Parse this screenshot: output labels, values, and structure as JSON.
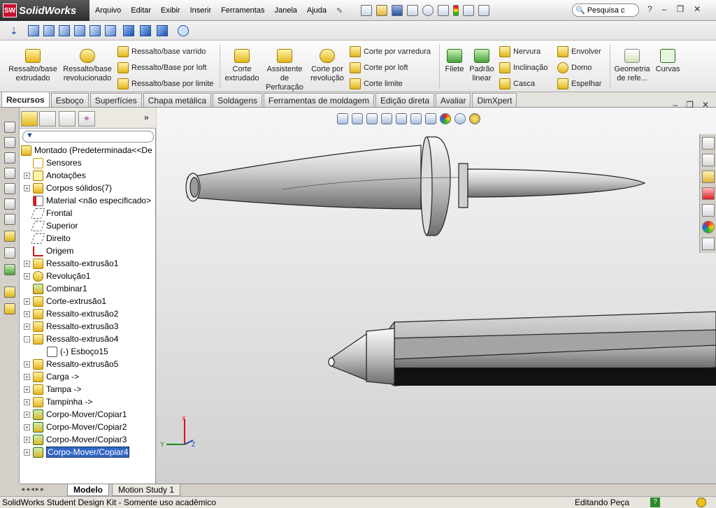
{
  "app": {
    "name": "SolidWorks",
    "logo_letters": "SW"
  },
  "menu": [
    "Arquivo",
    "Editar",
    "Exibir",
    "Inserir",
    "Ferramentas",
    "Janela",
    "Ajuda"
  ],
  "search": {
    "placeholder": "Pesquisa c"
  },
  "command_manager": {
    "big": [
      {
        "label": "Ressalto/base extrudado"
      },
      {
        "label": "Ressalto/base revolucionado"
      },
      {
        "label": "Corte extrudado"
      },
      {
        "label": "Assistente de Perfuração"
      },
      {
        "label": "Corte por revolução"
      },
      {
        "label": "Filete"
      },
      {
        "label": "Padrão linear"
      },
      {
        "label": "Geometria de refe..."
      },
      {
        "label": "Curvas"
      }
    ],
    "small": [
      {
        "label": "Ressalto/base varrido"
      },
      {
        "label": "Ressalto/Base por loft"
      },
      {
        "label": "Ressalto/base por limite"
      },
      {
        "label": "Corte por varredura"
      },
      {
        "label": "Corte por loft"
      },
      {
        "label": "Corte limite"
      },
      {
        "label": "Nervura"
      },
      {
        "label": "Inclinação"
      },
      {
        "label": "Casca"
      },
      {
        "label": "Envolver"
      },
      {
        "label": "Domo"
      },
      {
        "label": "Espelhar"
      }
    ]
  },
  "tabs": [
    "Recursos",
    "Esboço",
    "Superfícies",
    "Chapa metálica",
    "Soldagens",
    "Ferramentas de moldagem",
    "Edição direta",
    "Avaliar",
    "DimXpert"
  ],
  "tree": [
    {
      "label": "Montado  (Predeterminada<<De",
      "expand": "",
      "icon": "part",
      "indent": 0
    },
    {
      "label": "Sensores",
      "expand": "",
      "icon": "sensor",
      "indent": 1
    },
    {
      "label": "Anotações",
      "expand": "+",
      "icon": "annot",
      "indent": 1
    },
    {
      "label": "Corpos sólidos(7)",
      "expand": "+",
      "icon": "folder",
      "indent": 1
    },
    {
      "label": "Material <não especificado>",
      "expand": "",
      "icon": "material",
      "indent": 1
    },
    {
      "label": "Frontal",
      "expand": "",
      "icon": "plane",
      "indent": 1
    },
    {
      "label": "Superior",
      "expand": "",
      "icon": "plane",
      "indent": 1
    },
    {
      "label": "Direito",
      "expand": "",
      "icon": "plane",
      "indent": 1
    },
    {
      "label": "Origem",
      "expand": "",
      "icon": "origin",
      "indent": 1
    },
    {
      "label": "Ressalto-extrusão1",
      "expand": "+",
      "icon": "extrude",
      "indent": 1
    },
    {
      "label": "Revolução1",
      "expand": "+",
      "icon": "revolve",
      "indent": 1
    },
    {
      "label": "Combinar1",
      "expand": "",
      "icon": "combine",
      "indent": 1
    },
    {
      "label": "Corte-extrusão1",
      "expand": "+",
      "icon": "extrude",
      "indent": 1
    },
    {
      "label": "Ressalto-extrusão2",
      "expand": "+",
      "icon": "extrude",
      "indent": 1
    },
    {
      "label": "Ressalto-extrusão3",
      "expand": "+",
      "icon": "extrude",
      "indent": 1
    },
    {
      "label": "Ressalto-extrusão4",
      "expand": "-",
      "icon": "extrude",
      "indent": 1
    },
    {
      "label": "(-) Esboço15",
      "expand": "",
      "icon": "sketch",
      "indent": 2
    },
    {
      "label": "Ressalto-extrusão5",
      "expand": "+",
      "icon": "extrude",
      "indent": 1
    },
    {
      "label": "Carga ->",
      "expand": "+",
      "icon": "part",
      "indent": 1
    },
    {
      "label": "Tampa ->",
      "expand": "+",
      "icon": "part",
      "indent": 1
    },
    {
      "label": "Tampinha ->",
      "expand": "+",
      "icon": "part",
      "indent": 1
    },
    {
      "label": "Corpo-Mover/Copiar1",
      "expand": "+",
      "icon": "move",
      "indent": 1
    },
    {
      "label": "Corpo-Mover/Copiar2",
      "expand": "+",
      "icon": "move",
      "indent": 1
    },
    {
      "label": "Corpo-Mover/Copiar3",
      "expand": "+",
      "icon": "move",
      "indent": 1
    },
    {
      "label": "Corpo-Mover/Copiar4",
      "expand": "+",
      "icon": "move",
      "indent": 1,
      "selected": true
    }
  ],
  "bottom_tabs": [
    "Modelo",
    "Motion Study 1"
  ],
  "status": {
    "left": "SolidWorks Student Design Kit - Somente uso acadêmico",
    "right": "Editando Peça"
  },
  "triad": {
    "x": "X",
    "y": "Y",
    "z": "Z"
  },
  "colors": {
    "selection": "#3167c6",
    "accent_red": "#c8102e",
    "viewport_top": "#f6f6f6",
    "viewport_bottom": "#d0d0d0"
  }
}
